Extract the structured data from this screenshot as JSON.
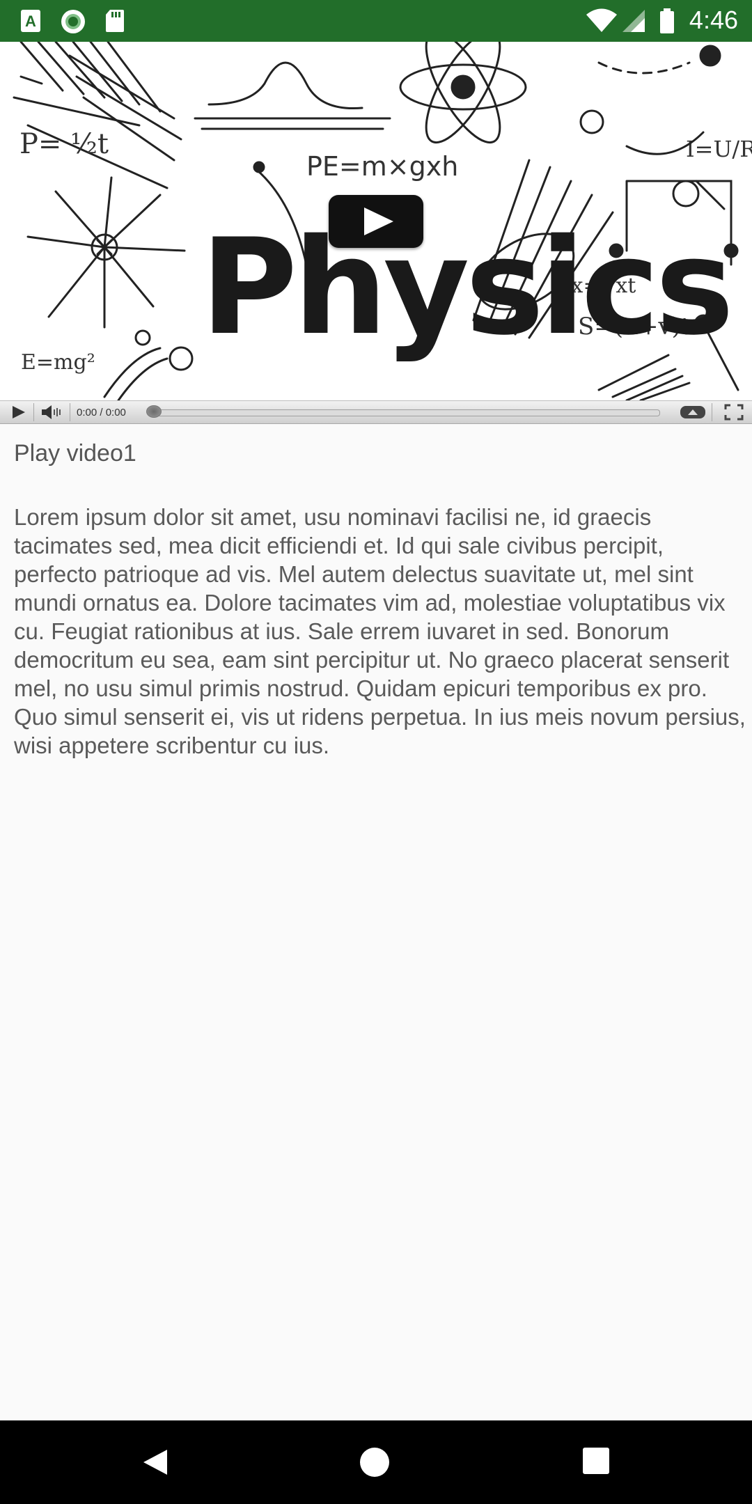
{
  "status_bar": {
    "time": "4:46",
    "left_icons": [
      "accessibility-a-icon",
      "sync-circle-icon",
      "sd-card-icon"
    ],
    "right_icons": [
      "wifi-icon",
      "signal-icon",
      "battery-icon"
    ],
    "background": "#226e2a"
  },
  "video": {
    "poster_word": "Physics",
    "poster_formula_1": "PE=m×gxh",
    "poster_formula_2": "I=U/R",
    "time_display": "0:00 / 0:00",
    "progress": 0
  },
  "content": {
    "title": "Play video1",
    "paragraph": "Lorem ipsum dolor sit amet, usu nominavi facilisi ne, id graecis tacimates sed, mea dicit efficiendi et. Id qui sale civibus percipit, perfecto patrioque ad vis. Mel autem delectus suavitate ut, mel sint mundi ornatus ea. Dolore tacimates vim ad, molestiae voluptatibus vix cu. Feugiat rationibus at ius. Sale errem iuvaret in sed. Bonorum democritum eu sea, eam sint percipitur ut. No graeco placerat senserit mel, no usu simul primis nostrud. Quidam epicuri temporibus ex pro. Quo simul senserit ei, vis ut ridens perpetua. In ius meis novum persius, wisi appetere scribentur cu ius."
  },
  "nav_bar": {
    "buttons": [
      "back-icon",
      "home-icon",
      "recents-icon"
    ]
  }
}
